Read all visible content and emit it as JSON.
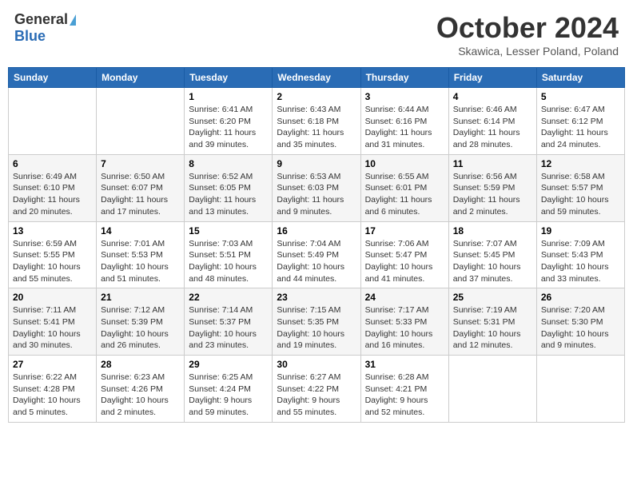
{
  "logo": {
    "general": "General",
    "blue": "Blue"
  },
  "title": "October 2024",
  "subtitle": "Skawica, Lesser Poland, Poland",
  "weekdays": [
    "Sunday",
    "Monday",
    "Tuesday",
    "Wednesday",
    "Thursday",
    "Friday",
    "Saturday"
  ],
  "weeks": [
    [
      {
        "day": "",
        "info": ""
      },
      {
        "day": "",
        "info": ""
      },
      {
        "day": "1",
        "info": "Sunrise: 6:41 AM\nSunset: 6:20 PM\nDaylight: 11 hours and 39 minutes."
      },
      {
        "day": "2",
        "info": "Sunrise: 6:43 AM\nSunset: 6:18 PM\nDaylight: 11 hours and 35 minutes."
      },
      {
        "day": "3",
        "info": "Sunrise: 6:44 AM\nSunset: 6:16 PM\nDaylight: 11 hours and 31 minutes."
      },
      {
        "day": "4",
        "info": "Sunrise: 6:46 AM\nSunset: 6:14 PM\nDaylight: 11 hours and 28 minutes."
      },
      {
        "day": "5",
        "info": "Sunrise: 6:47 AM\nSunset: 6:12 PM\nDaylight: 11 hours and 24 minutes."
      }
    ],
    [
      {
        "day": "6",
        "info": "Sunrise: 6:49 AM\nSunset: 6:10 PM\nDaylight: 11 hours and 20 minutes."
      },
      {
        "day": "7",
        "info": "Sunrise: 6:50 AM\nSunset: 6:07 PM\nDaylight: 11 hours and 17 minutes."
      },
      {
        "day": "8",
        "info": "Sunrise: 6:52 AM\nSunset: 6:05 PM\nDaylight: 11 hours and 13 minutes."
      },
      {
        "day": "9",
        "info": "Sunrise: 6:53 AM\nSunset: 6:03 PM\nDaylight: 11 hours and 9 minutes."
      },
      {
        "day": "10",
        "info": "Sunrise: 6:55 AM\nSunset: 6:01 PM\nDaylight: 11 hours and 6 minutes."
      },
      {
        "day": "11",
        "info": "Sunrise: 6:56 AM\nSunset: 5:59 PM\nDaylight: 11 hours and 2 minutes."
      },
      {
        "day": "12",
        "info": "Sunrise: 6:58 AM\nSunset: 5:57 PM\nDaylight: 10 hours and 59 minutes."
      }
    ],
    [
      {
        "day": "13",
        "info": "Sunrise: 6:59 AM\nSunset: 5:55 PM\nDaylight: 10 hours and 55 minutes."
      },
      {
        "day": "14",
        "info": "Sunrise: 7:01 AM\nSunset: 5:53 PM\nDaylight: 10 hours and 51 minutes."
      },
      {
        "day": "15",
        "info": "Sunrise: 7:03 AM\nSunset: 5:51 PM\nDaylight: 10 hours and 48 minutes."
      },
      {
        "day": "16",
        "info": "Sunrise: 7:04 AM\nSunset: 5:49 PM\nDaylight: 10 hours and 44 minutes."
      },
      {
        "day": "17",
        "info": "Sunrise: 7:06 AM\nSunset: 5:47 PM\nDaylight: 10 hours and 41 minutes."
      },
      {
        "day": "18",
        "info": "Sunrise: 7:07 AM\nSunset: 5:45 PM\nDaylight: 10 hours and 37 minutes."
      },
      {
        "day": "19",
        "info": "Sunrise: 7:09 AM\nSunset: 5:43 PM\nDaylight: 10 hours and 33 minutes."
      }
    ],
    [
      {
        "day": "20",
        "info": "Sunrise: 7:11 AM\nSunset: 5:41 PM\nDaylight: 10 hours and 30 minutes."
      },
      {
        "day": "21",
        "info": "Sunrise: 7:12 AM\nSunset: 5:39 PM\nDaylight: 10 hours and 26 minutes."
      },
      {
        "day": "22",
        "info": "Sunrise: 7:14 AM\nSunset: 5:37 PM\nDaylight: 10 hours and 23 minutes."
      },
      {
        "day": "23",
        "info": "Sunrise: 7:15 AM\nSunset: 5:35 PM\nDaylight: 10 hours and 19 minutes."
      },
      {
        "day": "24",
        "info": "Sunrise: 7:17 AM\nSunset: 5:33 PM\nDaylight: 10 hours and 16 minutes."
      },
      {
        "day": "25",
        "info": "Sunrise: 7:19 AM\nSunset: 5:31 PM\nDaylight: 10 hours and 12 minutes."
      },
      {
        "day": "26",
        "info": "Sunrise: 7:20 AM\nSunset: 5:30 PM\nDaylight: 10 hours and 9 minutes."
      }
    ],
    [
      {
        "day": "27",
        "info": "Sunrise: 6:22 AM\nSunset: 4:28 PM\nDaylight: 10 hours and 5 minutes."
      },
      {
        "day": "28",
        "info": "Sunrise: 6:23 AM\nSunset: 4:26 PM\nDaylight: 10 hours and 2 minutes."
      },
      {
        "day": "29",
        "info": "Sunrise: 6:25 AM\nSunset: 4:24 PM\nDaylight: 9 hours and 59 minutes."
      },
      {
        "day": "30",
        "info": "Sunrise: 6:27 AM\nSunset: 4:22 PM\nDaylight: 9 hours and 55 minutes."
      },
      {
        "day": "31",
        "info": "Sunrise: 6:28 AM\nSunset: 4:21 PM\nDaylight: 9 hours and 52 minutes."
      },
      {
        "day": "",
        "info": ""
      },
      {
        "day": "",
        "info": ""
      }
    ]
  ]
}
